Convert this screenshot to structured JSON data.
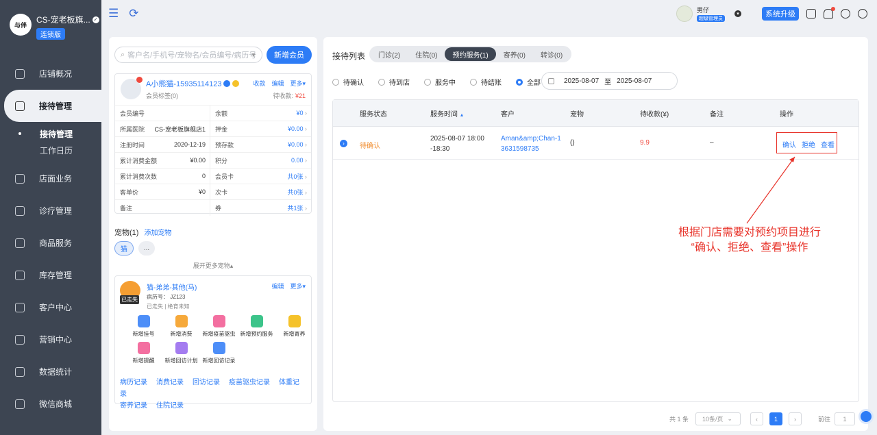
{
  "sidebar": {
    "shop_name": "CS-宠老板旗...",
    "logo_text": "与伴",
    "edition": "连锁版",
    "items": [
      {
        "label": "店铺概况"
      },
      {
        "label": "接待管理"
      },
      {
        "label": "店面业务"
      },
      {
        "label": "诊疗管理"
      },
      {
        "label": "商品服务"
      },
      {
        "label": "库存管理"
      },
      {
        "label": "客户中心"
      },
      {
        "label": "营销中心"
      },
      {
        "label": "数据统计"
      },
      {
        "label": "微信商城"
      }
    ],
    "sub_items": [
      {
        "label": "接待管理"
      },
      {
        "label": "工作日历"
      }
    ]
  },
  "topbar": {
    "user_name": "男仔",
    "user_role": "超级管理员",
    "upgrade_label": "系统升级"
  },
  "left": {
    "search_placeholder": "客户名/手机号/宠物名/会员编号/病历号",
    "new_member_label": "新增会员",
    "member": {
      "name": "A小熊猫-15935114123",
      "tag": "会员标签(0)",
      "collect": "收款",
      "edit": "编辑",
      "more": "更多▾",
      "due_label": "待收款:",
      "due_value": "¥21",
      "fields_left": [
        {
          "k": "会员编号",
          "v": ""
        },
        {
          "k": "所属医院",
          "v": "CS-宠老板旗舰店1"
        },
        {
          "k": "注册时间",
          "v": "2020-12-19"
        },
        {
          "k": "累计消费金额",
          "v": "¥0.00"
        },
        {
          "k": "累计消费次数",
          "v": "0"
        },
        {
          "k": "客单价",
          "v": "¥0"
        },
        {
          "k": "备注",
          "v": ""
        }
      ],
      "fields_right": [
        {
          "k": "余额",
          "v": "¥0"
        },
        {
          "k": "押金",
          "v": "¥0.00"
        },
        {
          "k": "预存款",
          "v": "¥0.00"
        },
        {
          "k": "积分",
          "v": "0.00"
        },
        {
          "k": "会员卡",
          "v": "共0张"
        },
        {
          "k": "次卡",
          "v": "共0张"
        },
        {
          "k": "券",
          "v": "共1张"
        }
      ]
    },
    "pets_header": "宠物(1)",
    "add_pet": "添加宠物",
    "pet_chip": "猫",
    "pet_more": "...",
    "expand_more": "展开更多宠物▴",
    "pet": {
      "name": "猫-弟弟-其他(马)",
      "lost_badge": "已走失",
      "record_no": "病历号：  JZ123",
      "status": "已走失 | 绝育未知",
      "edit": "编辑",
      "more": "更多▾",
      "quick_actions": [
        {
          "label": "新增挂号",
          "color": "#4d8ef8"
        },
        {
          "label": "新增消费",
          "color": "#f6a93b"
        },
        {
          "label": "新增疫苗驱虫",
          "color": "#f36fa0"
        },
        {
          "label": "新增预约服务",
          "color": "#3cc48a"
        },
        {
          "label": "新增寄养",
          "color": "#f5c22a"
        },
        {
          "label": "新增提醒",
          "color": "#f36fa0"
        },
        {
          "label": "新增回访计划",
          "color": "#a47cf0"
        },
        {
          "label": "新增回访记录",
          "color": "#4d8ef8"
        }
      ],
      "links": [
        "病历记录",
        "消费记录",
        "回访记录",
        "疫苗驱虫记录",
        "体重记录",
        "寄养记录",
        "住院记录"
      ]
    }
  },
  "right": {
    "title": "接待列表",
    "tabs": [
      {
        "label": "门诊(2)"
      },
      {
        "label": "住院(0)"
      },
      {
        "label": "预约服务(1)"
      },
      {
        "label": "寄养(0)"
      },
      {
        "label": "转诊(0)"
      }
    ],
    "filters": [
      {
        "label": "待确认"
      },
      {
        "label": "待到店"
      },
      {
        "label": "服务中"
      },
      {
        "label": "待结账"
      },
      {
        "label": "全部"
      }
    ],
    "date_from": "2025-08-07",
    "date_to_label": "至",
    "date_to": "2025-08-07",
    "columns": [
      "服务状态",
      "服务时间",
      "客户",
      "宠物",
      "待收款(¥)",
      "备注",
      "操作"
    ],
    "rows": [
      {
        "status": "待确认",
        "time_line1": "2025-08-07 18:00",
        "time_line2": "-18:30",
        "customer_line1": "Aman&amp;Chan-1",
        "customer_line2": "3631598735",
        "pet": "()",
        "due": "9.9",
        "note": "–",
        "op_confirm": "确认",
        "op_reject": "拒绝",
        "op_view": "查看"
      }
    ],
    "pager": {
      "total": "共 1 条",
      "page_size": "10条/页",
      "current": "1",
      "goto_label": "前往",
      "goto_value": "1",
      "prev": "‹",
      "next": "›"
    }
  },
  "annotation": {
    "line1": "根据门店需要对预约项目进行",
    "line2": "“确认、拒绝、查看”操作",
    "color": "#e8332a"
  }
}
